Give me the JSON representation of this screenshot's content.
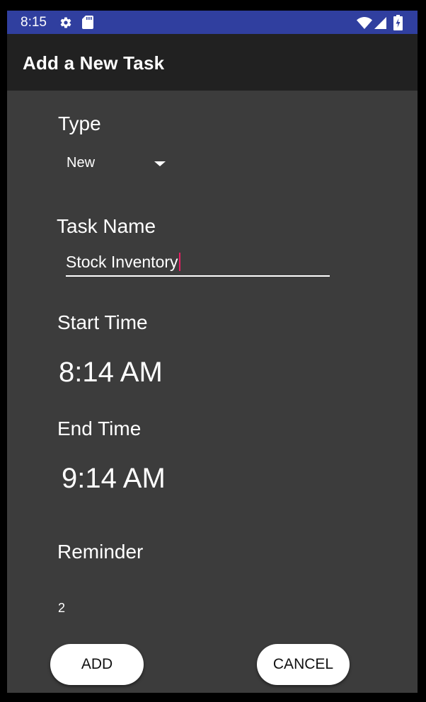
{
  "status_bar": {
    "time": "8:15",
    "icons": [
      "gear-icon",
      "sd-card-icon",
      "wifi-icon",
      "signal-icon",
      "battery-charging-icon"
    ],
    "background_color": "#303f9f"
  },
  "app_bar": {
    "title": "Add a New Task",
    "background_color": "#212121"
  },
  "form": {
    "type_label": "Type",
    "type_selected": "New",
    "task_name_label": "Task Name",
    "task_name_value": "Stock Inventory",
    "start_time_label": "Start Time",
    "start_time_value": "8:14 AM",
    "end_time_label": "End Time",
    "end_time_value": "9:14 AM",
    "reminder_label": "Reminder",
    "reminder_value": "2"
  },
  "buttons": {
    "add": "ADD",
    "cancel": "CANCEL"
  },
  "colors": {
    "content_background": "#3c3c3c",
    "cursor_accent": "#e91e63"
  }
}
